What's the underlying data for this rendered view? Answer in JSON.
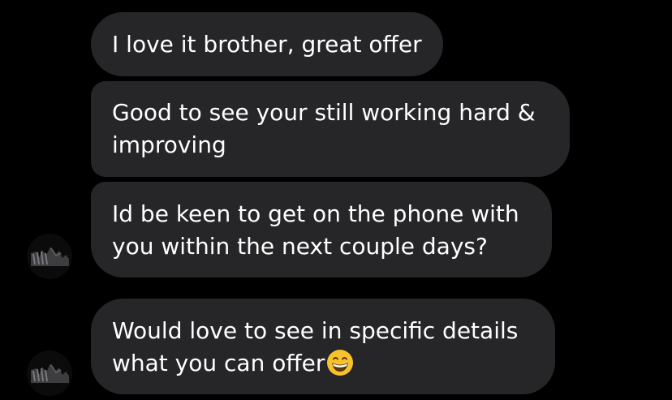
{
  "messages": [
    {
      "lines": [
        "I love it brother, great offer"
      ]
    },
    {
      "lines": [
        "Good to see your still working hard &",
        "improving"
      ]
    },
    {
      "lines": [
        "Id be keen to get on the phone with",
        "you within the next couple days?"
      ]
    },
    {
      "lines": [
        "Would love to see in specific details",
        "what you can offer"
      ],
      "trailing_emoji": "grinning-face-with-smiling-eyes"
    }
  ],
  "avatars": [
    {
      "icon": "profile-avatar"
    },
    {
      "icon": "profile-avatar"
    }
  ],
  "colors": {
    "background": "#000000",
    "bubble": "#262628",
    "text": "#ffffff",
    "emoji": "#f7c22c"
  }
}
